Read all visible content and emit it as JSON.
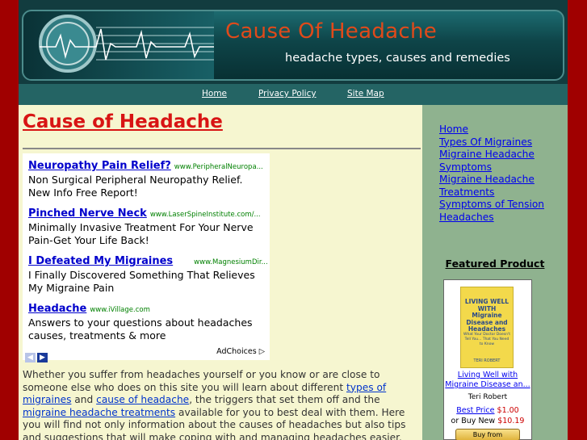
{
  "header": {
    "title": "Cause Of Headache",
    "tagline": "headache types, causes and remedies"
  },
  "nav": [
    {
      "label": "Home"
    },
    {
      "label": "Privacy Policy"
    },
    {
      "label": "Site Map"
    }
  ],
  "main": {
    "title": "Cause of Headache",
    "ads": [
      {
        "headline": "Neuropathy Pain Relief?",
        "url": "www.PeripheralNeuropa...",
        "desc": "Non Surgical Peripheral Neuropathy Relief. New Info Free Report!"
      },
      {
        "headline": "Pinched Nerve Neck",
        "url": "www.LaserSpineInstitute.com/...",
        "desc": "Minimally Invasive Treatment For Your Nerve Pain-Get Your Life Back!"
      },
      {
        "headline": "I Defeated My Migraines",
        "url": "www.MagnesiumDir...",
        "desc": "I Finally Discovered Something That Relieves My Migraine Pain"
      },
      {
        "headline": "Headache",
        "url": "www.iVillage.com",
        "desc": "Answers to your questions about headaches causes, treatments & more"
      }
    ],
    "adchoices": "AdChoices",
    "body": {
      "t1": "Whether you suffer from headaches yourself or you know or are close to someone else who does on this site you will learn about different ",
      "l1": "types of migraines",
      "t2": " and ",
      "l2": "cause of headache",
      "t3": ", the triggers that set them off and the ",
      "l3": "migraine headache treatments",
      "t4": " available  for you to best deal with them. Here you will find not only information about the causes of headaches but also tips and suggestions that will make coping with and managing headaches easier."
    }
  },
  "sidebar": {
    "links": [
      {
        "label": "Home"
      },
      {
        "label": "Types Of Migraines"
      },
      {
        "label": "Migraine Headache Symptoms"
      },
      {
        "label": "Migraine Headache Treatments"
      },
      {
        "label": "Symptoms of Tension Headaches"
      }
    ],
    "featured_label": "Featured Product",
    "product": {
      "cover_title": "LIVING WELL WITH Migraine Disease and Headaches",
      "cover_sub": "What Your Doctor Doesn't Tell You... That You Need to Know",
      "cover_author": "TERI ROBERT",
      "title": "Living Well with Migraine Disease an...",
      "author": "Teri Robert",
      "best_price_label": "Best Price",
      "best_price": "$1.00",
      "buy_new_label": "or Buy New",
      "buy_new": "$10.19",
      "buy_button": "Buy from amazon.com"
    }
  },
  "colors": {
    "outer_bg": "#8b0000",
    "content_bg": "#f6f6d0",
    "sidebar_bg": "#8fb28f",
    "header_bg": "#123c3f",
    "title_red": "#d81414",
    "link_blue": "#0000ee"
  }
}
